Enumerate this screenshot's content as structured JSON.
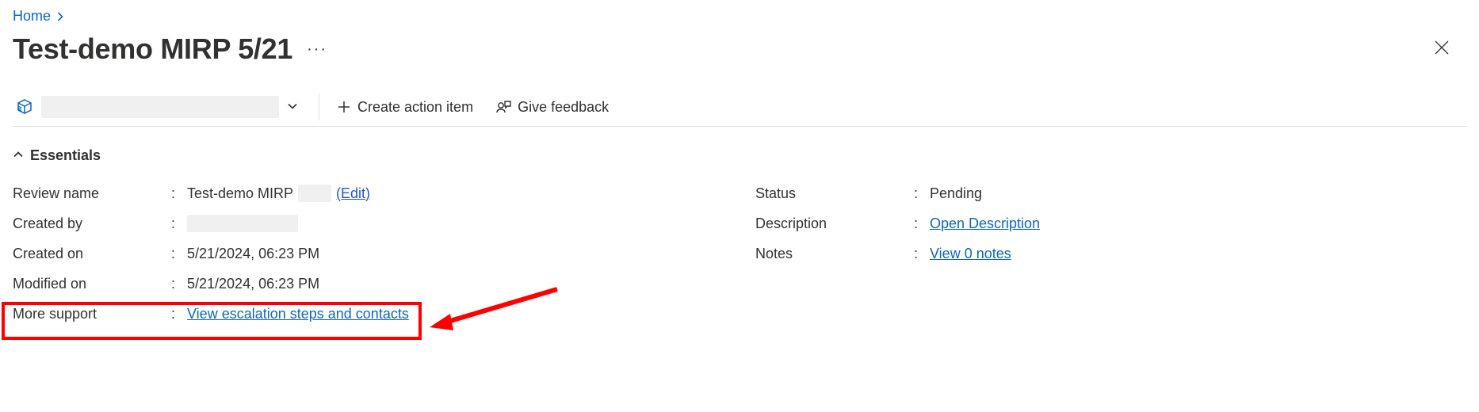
{
  "breadcrumb": {
    "home": "Home"
  },
  "title": "Test-demo MIRP 5/21",
  "toolbar": {
    "create_action_item": "Create action item",
    "give_feedback": "Give feedback"
  },
  "essentials": {
    "header": "Essentials",
    "left": {
      "review_name_label": "Review name",
      "review_name_value": "Test-demo MIRP",
      "review_name_edit": "(Edit)",
      "created_by_label": "Created by",
      "created_on_label": "Created on",
      "created_on_value": "5/21/2024, 06:23 PM",
      "modified_on_label": "Modified on",
      "modified_on_value": "5/21/2024, 06:23 PM",
      "more_support_label": "More support",
      "more_support_link": "View escalation steps and contacts"
    },
    "right": {
      "status_label": "Status",
      "status_value": "Pending",
      "description_label": "Description",
      "description_link": "Open Description",
      "notes_label": "Notes",
      "notes_link": "View 0 notes"
    }
  }
}
